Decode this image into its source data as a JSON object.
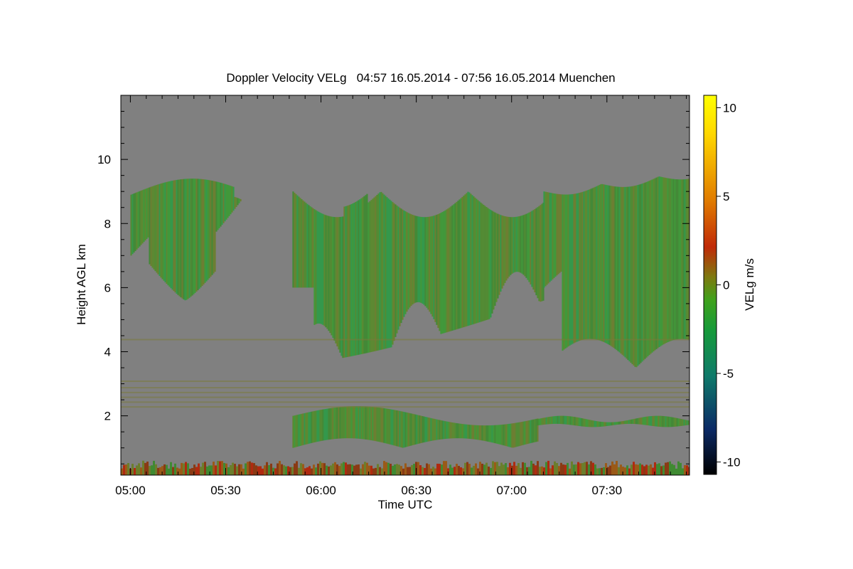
{
  "chart_data": {
    "type": "heatmap",
    "title": "Doppler Velocity VELg   04:57 16.05.2014 - 07:56 16.05.2014 Muenchen",
    "xlabel": "Time UTC",
    "ylabel": "Height AGL km",
    "colorbar_label": "VELg m/s",
    "x_range_minutes_utc": [
      297,
      476
    ],
    "y_range_km": [
      0.15,
      12.0
    ],
    "x_ticks": [
      {
        "minute": 300,
        "label": "05:00"
      },
      {
        "minute": 330,
        "label": "05:30"
      },
      {
        "minute": 360,
        "label": "06:00"
      },
      {
        "minute": 390,
        "label": "06:30"
      },
      {
        "minute": 420,
        "label": "07:00"
      },
      {
        "minute": 450,
        "label": "07:30"
      }
    ],
    "y_ticks": [
      {
        "km": 2,
        "label": "2"
      },
      {
        "km": 4,
        "label": "4"
      },
      {
        "km": 6,
        "label": "6"
      },
      {
        "km": 8,
        "label": "8"
      },
      {
        "km": 10,
        "label": "10"
      }
    ],
    "colorbar_range": [
      -10.7,
      10.7
    ],
    "colorbar_ticks": [
      {
        "value": 10,
        "label": "10"
      },
      {
        "value": 5,
        "label": "5"
      },
      {
        "value": 0,
        "label": "0"
      },
      {
        "value": -5,
        "label": "-5"
      },
      {
        "value": -10,
        "label": "-10"
      }
    ],
    "colors": {
      "background_no_signal": "#808080",
      "cloud_main": "#4f8c2f",
      "cloud_dark": "#3f8a32",
      "cloud_olive": "#6b7e2c",
      "colormap": [
        "#000000",
        "#0b2a66",
        "#0f7a6a",
        "#169a3a",
        "#3fa21c",
        "#7d7a10",
        "#c02a08",
        "#e07a00",
        "#ffd800",
        "#ffff00"
      ]
    },
    "features": [
      {
        "name": "upper cloud 1",
        "time_start": "05:00",
        "time_end": "05:38",
        "height_km": [
          5.6,
          9.5
        ],
        "mean_velocity_ms": -0.8
      },
      {
        "name": "upper cloud 2 fall streaks",
        "time_start": "05:51",
        "time_end": "07:10",
        "height_km": [
          3.6,
          9.3
        ],
        "mean_velocity_ms": -1.2
      },
      {
        "name": "upper cloud 3",
        "time_start": "07:10",
        "time_end": "07:56",
        "height_km": [
          3.5,
          9.7
        ],
        "mean_velocity_ms": -0.5
      },
      {
        "name": "mid-level layer",
        "time_start": "05:51",
        "time_end": "07:08",
        "height_km": [
          1.0,
          2.3
        ],
        "mean_velocity_ms": -0.7
      },
      {
        "name": "boundary layer",
        "time_start": "04:57",
        "time_end": "07:56",
        "height_km": [
          0.15,
          0.6
        ],
        "mean_velocity_ms": 0.5
      }
    ]
  }
}
